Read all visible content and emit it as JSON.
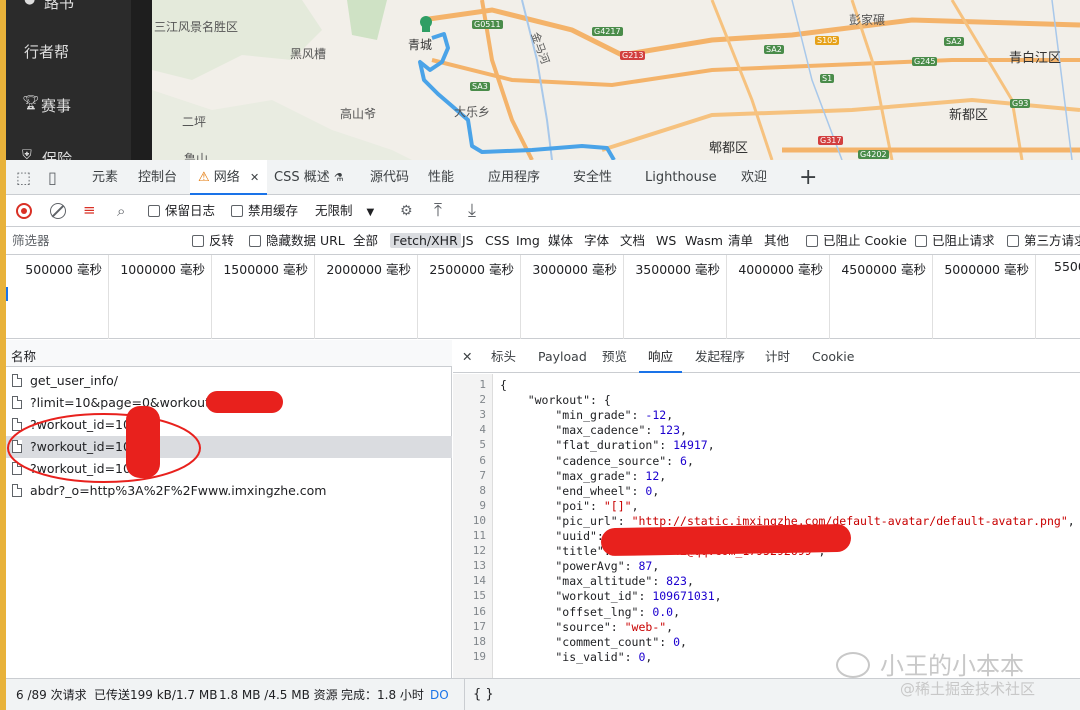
{
  "left_nav": {
    "items": [
      {
        "icon": "user-icon",
        "label": "路书"
      },
      {
        "icon": "",
        "label": "行者帮"
      },
      {
        "icon": "trophy-icon",
        "label": "赛事"
      },
      {
        "icon": "shield-icon",
        "label": "保险"
      }
    ]
  },
  "map": {
    "labels": [
      "三江风景名胜区",
      "黑风槽",
      "高山爷",
      "二坪",
      "青城",
      "大乐乡",
      "彭家碾",
      "新都区",
      "郫都区",
      "青白江区",
      "金马河",
      "鲁山"
    ],
    "roads": [
      "G0511",
      "G4217",
      "G213",
      "SA2",
      "S105",
      "SA3",
      "S1",
      "G245",
      "G93",
      "G317",
      "G4202",
      "SA2"
    ]
  },
  "devtools": {
    "tabs": [
      {
        "label": "元素"
      },
      {
        "label": "控制台"
      },
      {
        "label": "网络",
        "active": true,
        "warning": true
      },
      {
        "label": "CSS 概述",
        "flask": true
      },
      {
        "label": "源代码"
      },
      {
        "label": "性能"
      },
      {
        "label": "应用程序"
      },
      {
        "label": "安全性"
      },
      {
        "label": "Lighthouse"
      },
      {
        "label": "欢迎"
      }
    ],
    "close_glyph": "✕",
    "add_glyph": "+"
  },
  "toolbar": {
    "preserve_log": "保留日志",
    "disable_cache": "禁用缓存",
    "throttle": "无限制"
  },
  "filter": {
    "placeholder": "筛选器",
    "invert": "反转",
    "hide_data_url": "隐藏数据 URL",
    "types": [
      "全部",
      "Fetch/XHR",
      "JS",
      "CSS",
      "Img",
      "媒体",
      "字体",
      "文档",
      "WS",
      "Wasm",
      "清单",
      "其他"
    ],
    "blocked_cookies": "已阻止 Cookie",
    "blocked_requests": "已阻止请求",
    "third_party": "第三方请求"
  },
  "timeline": {
    "ticks": [
      "500000 毫秒",
      "1000000 毫秒",
      "1500000 毫秒",
      "2000000 毫秒",
      "2500000 毫秒",
      "3000000 毫秒",
      "3500000 毫秒",
      "4000000 毫秒",
      "4500000 毫秒",
      "5000000 毫秒",
      "5500"
    ]
  },
  "requests": {
    "header": "名称",
    "rows": [
      {
        "name": "get_user_info/",
        "selected": false
      },
      {
        "name": "?limit=10&page=0&workout_id",
        "selected": false
      },
      {
        "name": "?workout_id=10         1",
        "selected": false
      },
      {
        "name": "?workout_id=10         1",
        "selected": true
      },
      {
        "name": "?workout_id=10         1",
        "selected": false
      },
      {
        "name": "abdr?_o=http%3A%2F%2Fwww.imxingzhe.com",
        "selected": false
      }
    ]
  },
  "detail": {
    "tabs": [
      {
        "label": "标头"
      },
      {
        "label": "Payload"
      },
      {
        "label": "预览"
      },
      {
        "label": "响应",
        "active": true
      },
      {
        "label": "发起程序"
      },
      {
        "label": "计时"
      },
      {
        "label": "Cookie"
      }
    ],
    "lines": [
      {
        "n": "1",
        "text": "{"
      },
      {
        "n": "2",
        "text": "    \"workout\": {"
      },
      {
        "n": "3",
        "key": "min_grade",
        "val": "-12",
        "type": "num"
      },
      {
        "n": "4",
        "key": "max_cadence",
        "val": "123",
        "type": "num"
      },
      {
        "n": "5",
        "key": "flat_duration",
        "val": "14917",
        "type": "num"
      },
      {
        "n": "6",
        "key": "cadence_source",
        "val": "6",
        "type": "num"
      },
      {
        "n": "7",
        "key": "max_grade",
        "val": "12",
        "type": "num"
      },
      {
        "n": "8",
        "key": "end_wheel",
        "val": "0",
        "type": "num"
      },
      {
        "n": "9",
        "key": "poi",
        "val": "\"[]\"",
        "type": "str"
      },
      {
        "n": "10",
        "key": "pic_url",
        "val": "\"http://static.imxingzhe.com/default-avatar/default-avatar.png\"",
        "type": "str"
      },
      {
        "n": "11",
        "key": "uuid",
        "val": "",
        "type": "str"
      },
      {
        "n": "12",
        "key": "title",
        "val": "\"236615042@qq.com_1795292699\"",
        "type": "str"
      },
      {
        "n": "13",
        "key": "powerAvg",
        "val": "87",
        "type": "num"
      },
      {
        "n": "14",
        "key": "max_altitude",
        "val": "823",
        "type": "num"
      },
      {
        "n": "15",
        "key": "workout_id",
        "val": "109671031",
        "type": "num"
      },
      {
        "n": "16",
        "key": "offset_lng",
        "val": "0.0",
        "type": "num"
      },
      {
        "n": "17",
        "key": "source",
        "val": "\"web-\"",
        "type": "str"
      },
      {
        "n": "18",
        "key": "comment_count",
        "val": "0",
        "type": "num"
      },
      {
        "n": "19",
        "key": "is_valid",
        "val": "0",
        "type": "num"
      }
    ],
    "pretty_print": "{ }"
  },
  "status": {
    "requests": "6 /89 次请求",
    "transferred": "已传送199 kB/1.7 MB",
    "resources": "1.8 MB /4.5 MB 资源",
    "finish": "完成：1.8 小时",
    "dom": "DO"
  },
  "watermark": {
    "line1": "小王的小本本",
    "line2": "@稀土掘金技术社区"
  },
  "colors": {
    "accent": "#1a73e8",
    "redact": "#e8211d",
    "route": "#4aa3e8"
  }
}
